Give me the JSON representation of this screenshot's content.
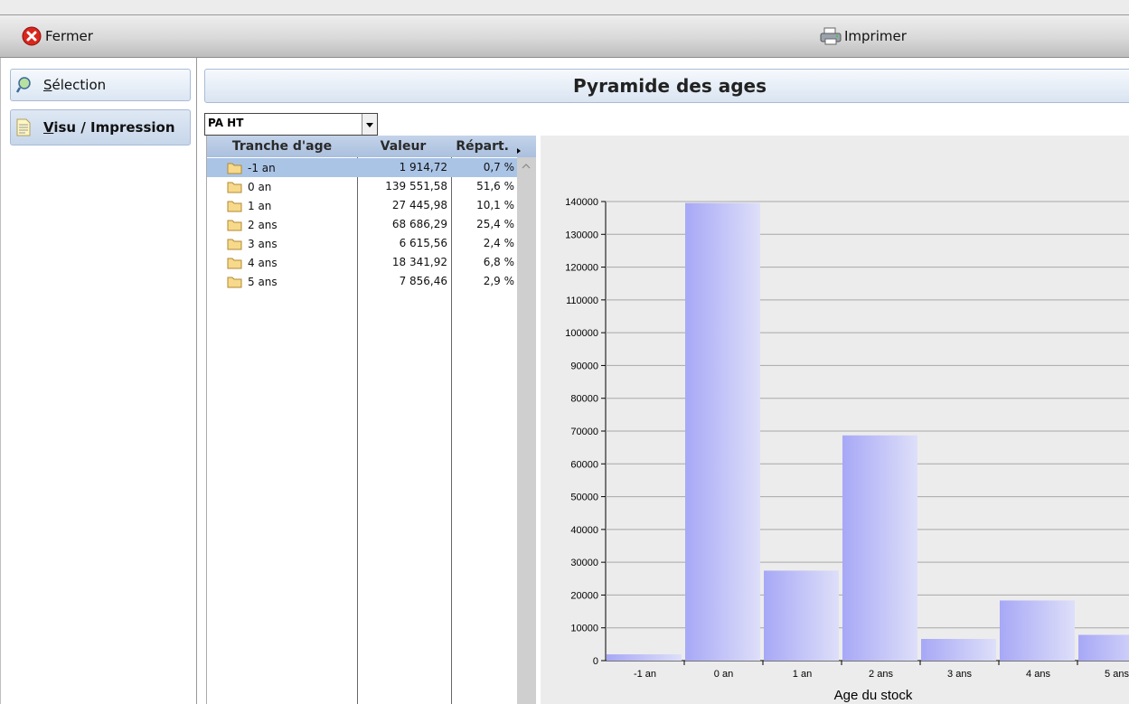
{
  "toolbar": {
    "close_label": "Fermer",
    "print_label": "Imprimer"
  },
  "sidebar": {
    "items": [
      {
        "label_hot": "S",
        "label_rest": "élection",
        "icon": "selection-icon"
      },
      {
        "label_hot": "V",
        "label_rest": "isu / Impression",
        "icon": "document-icon",
        "active": true
      }
    ]
  },
  "main": {
    "title": "Pyramide des ages",
    "combo_value": "PA HT",
    "grid": {
      "headers": {
        "age": "Tranche d'age",
        "value": "Valeur",
        "repart": "Répart."
      },
      "rows": [
        {
          "age": "-1 an",
          "value": "1 914,72",
          "repart": "0,7 %",
          "selected": true
        },
        {
          "age": "0 an",
          "value": "139 551,58",
          "repart": "51,6 %"
        },
        {
          "age": "1 an",
          "value": "27 445,98",
          "repart": "10,1 %"
        },
        {
          "age": "2 ans",
          "value": "68 686,29",
          "repart": "25,4 %"
        },
        {
          "age": "3 ans",
          "value": "6 615,56",
          "repart": "2,4 %"
        },
        {
          "age": "4 ans",
          "value": "18 341,92",
          "repart": "6,8 %"
        },
        {
          "age": "5 ans",
          "value": "7 856,46",
          "repart": "2,9 %"
        }
      ]
    }
  },
  "chart_data": {
    "type": "bar",
    "title": "",
    "xlabel": "Age du stock",
    "ylabel": "",
    "categories": [
      "-1 an",
      "0 an",
      "1 an",
      "2 ans",
      "3 ans",
      "4 ans",
      "5 ans"
    ],
    "values": [
      1914.72,
      139551.58,
      27445.98,
      68686.29,
      6615.56,
      18341.92,
      7856.46
    ],
    "ylim": [
      0,
      140000
    ],
    "yticks": [
      "0",
      "10000",
      "20000",
      "30000",
      "40000",
      "50000",
      "60000",
      "70000",
      "80000",
      "90000",
      "100000",
      "110000",
      "120000",
      "130000",
      "140000"
    ],
    "grid": true,
    "legend": "none",
    "bar_color": "#a7a8f6"
  }
}
